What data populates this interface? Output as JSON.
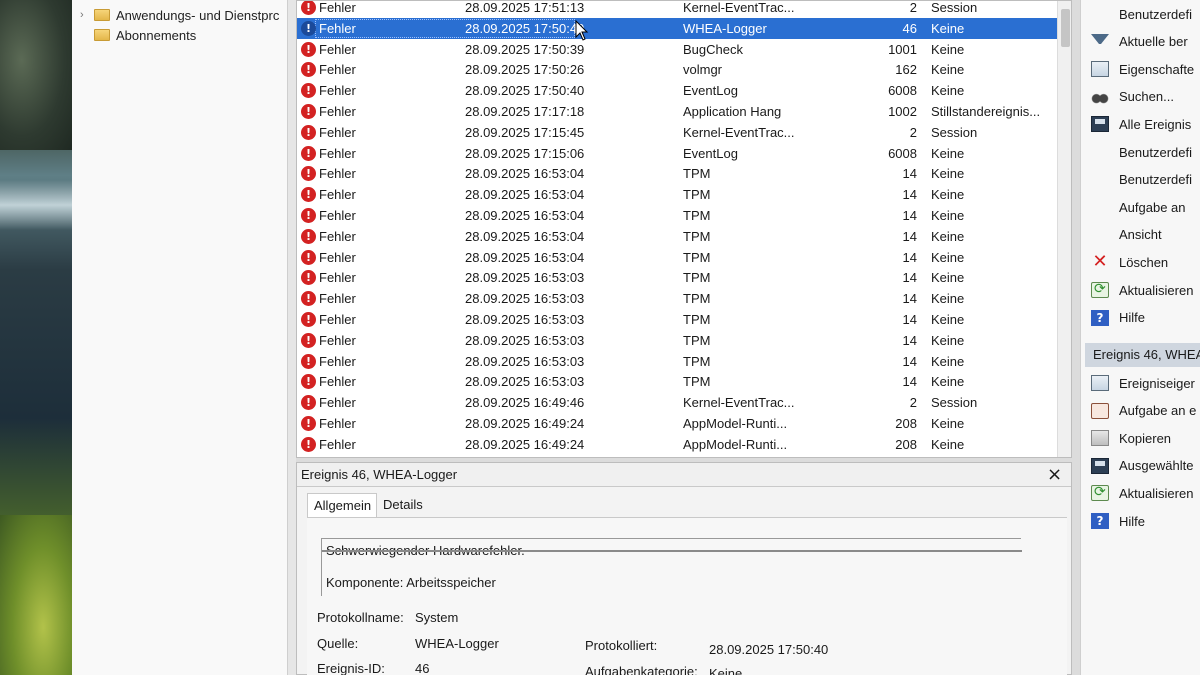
{
  "tree": {
    "items": [
      {
        "label": "Anwendungs- und Dienstprc",
        "expandable": true
      },
      {
        "label": "Abonnements",
        "expandable": false
      }
    ]
  },
  "events": {
    "rows": [
      {
        "level": "Fehler",
        "datetime": "28.09.2025 17:51:13",
        "source": "Kernel-EventTrac...",
        "event_id": "2",
        "category": "Session",
        "selected": false
      },
      {
        "level": "Fehler",
        "datetime": "28.09.2025 17:50:40",
        "source": "WHEA-Logger",
        "event_id": "46",
        "category": "Keine",
        "selected": true
      },
      {
        "level": "Fehler",
        "datetime": "28.09.2025 17:50:39",
        "source": "BugCheck",
        "event_id": "1001",
        "category": "Keine",
        "selected": false
      },
      {
        "level": "Fehler",
        "datetime": "28.09.2025 17:50:26",
        "source": "volmgr",
        "event_id": "162",
        "category": "Keine",
        "selected": false
      },
      {
        "level": "Fehler",
        "datetime": "28.09.2025 17:50:40",
        "source": "EventLog",
        "event_id": "6008",
        "category": "Keine",
        "selected": false
      },
      {
        "level": "Fehler",
        "datetime": "28.09.2025 17:17:18",
        "source": "Application Hang",
        "event_id": "1002",
        "category": "Stillstandereignis...",
        "selected": false
      },
      {
        "level": "Fehler",
        "datetime": "28.09.2025 17:15:45",
        "source": "Kernel-EventTrac...",
        "event_id": "2",
        "category": "Session",
        "selected": false
      },
      {
        "level": "Fehler",
        "datetime": "28.09.2025 17:15:06",
        "source": "EventLog",
        "event_id": "6008",
        "category": "Keine",
        "selected": false
      },
      {
        "level": "Fehler",
        "datetime": "28.09.2025 16:53:04",
        "source": "TPM",
        "event_id": "14",
        "category": "Keine",
        "selected": false
      },
      {
        "level": "Fehler",
        "datetime": "28.09.2025 16:53:04",
        "source": "TPM",
        "event_id": "14",
        "category": "Keine",
        "selected": false
      },
      {
        "level": "Fehler",
        "datetime": "28.09.2025 16:53:04",
        "source": "TPM",
        "event_id": "14",
        "category": "Keine",
        "selected": false
      },
      {
        "level": "Fehler",
        "datetime": "28.09.2025 16:53:04",
        "source": "TPM",
        "event_id": "14",
        "category": "Keine",
        "selected": false
      },
      {
        "level": "Fehler",
        "datetime": "28.09.2025 16:53:04",
        "source": "TPM",
        "event_id": "14",
        "category": "Keine",
        "selected": false
      },
      {
        "level": "Fehler",
        "datetime": "28.09.2025 16:53:03",
        "source": "TPM",
        "event_id": "14",
        "category": "Keine",
        "selected": false
      },
      {
        "level": "Fehler",
        "datetime": "28.09.2025 16:53:03",
        "source": "TPM",
        "event_id": "14",
        "category": "Keine",
        "selected": false
      },
      {
        "level": "Fehler",
        "datetime": "28.09.2025 16:53:03",
        "source": "TPM",
        "event_id": "14",
        "category": "Keine",
        "selected": false
      },
      {
        "level": "Fehler",
        "datetime": "28.09.2025 16:53:03",
        "source": "TPM",
        "event_id": "14",
        "category": "Keine",
        "selected": false
      },
      {
        "level": "Fehler",
        "datetime": "28.09.2025 16:53:03",
        "source": "TPM",
        "event_id": "14",
        "category": "Keine",
        "selected": false
      },
      {
        "level": "Fehler",
        "datetime": "28.09.2025 16:53:03",
        "source": "TPM",
        "event_id": "14",
        "category": "Keine",
        "selected": false
      },
      {
        "level": "Fehler",
        "datetime": "28.09.2025 16:49:46",
        "source": "Kernel-EventTrac...",
        "event_id": "2",
        "category": "Session",
        "selected": false
      },
      {
        "level": "Fehler",
        "datetime": "28.09.2025 16:49:24",
        "source": "AppModel-Runti...",
        "event_id": "208",
        "category": "Keine",
        "selected": false
      },
      {
        "level": "Fehler",
        "datetime": "28.09.2025 16:49:24",
        "source": "AppModel-Runti...",
        "event_id": "208",
        "category": "Keine",
        "selected": false
      }
    ]
  },
  "details": {
    "title": "Ereignis 46, WHEA-Logger",
    "tabs": [
      "Allgemein",
      "Details"
    ],
    "message_line1": "Schwerwiegender Hardwarefehler.",
    "message_line2": "Komponente: Arbeitsspeicher",
    "protokollname_label": "Protokollname:",
    "protokollname_value": "System",
    "quelle_label": "Quelle:",
    "quelle_value": "WHEA-Logger",
    "protokolliert_label": "Protokolliert:",
    "protokolliert_value": "28.09.2025 17:50:40",
    "ereignis_id_label": "Ereignis-ID:",
    "ereignis_id_value": "46",
    "aufgabenkategorie_label": "Aufgabenkategorie:",
    "aufgabenkategorie_value": "Keine"
  },
  "actions": {
    "items": [
      {
        "label": "Benutzerdefi",
        "icon": "none"
      },
      {
        "label": "Aktuelle ber",
        "icon": "filter-icon"
      },
      {
        "label": "Eigenschafte",
        "icon": "properties-icon"
      },
      {
        "label": "Suchen...",
        "icon": "binoculars-icon"
      },
      {
        "label": "Alle Ereignis",
        "icon": "save-icon"
      },
      {
        "label": "Benutzerdefi",
        "icon": "none"
      },
      {
        "label": "Benutzerdefi",
        "icon": "none"
      },
      {
        "label": "Aufgabe an",
        "icon": "none"
      },
      {
        "label": "Ansicht",
        "icon": "none"
      },
      {
        "label": "Löschen",
        "icon": "delete-icon"
      },
      {
        "label": "Aktualisieren",
        "icon": "refresh-icon"
      },
      {
        "label": "Hilfe",
        "icon": "help-icon"
      }
    ],
    "section_title": "Ereignis 46, WHEA",
    "section_items": [
      {
        "label": "Ereigniseiger",
        "icon": "properties-icon"
      },
      {
        "label": "Aufgabe an e",
        "icon": "task-icon"
      },
      {
        "label": "Kopieren",
        "icon": "copy-icon"
      },
      {
        "label": "Ausgewählte",
        "icon": "save-icon"
      },
      {
        "label": "Aktualisieren",
        "icon": "refresh-icon"
      },
      {
        "label": "Hilfe",
        "icon": "help-icon"
      }
    ]
  },
  "colors": {
    "selection": "#2a6fd2",
    "error_icon": "#d32222",
    "section_header": "#cfd6df"
  }
}
